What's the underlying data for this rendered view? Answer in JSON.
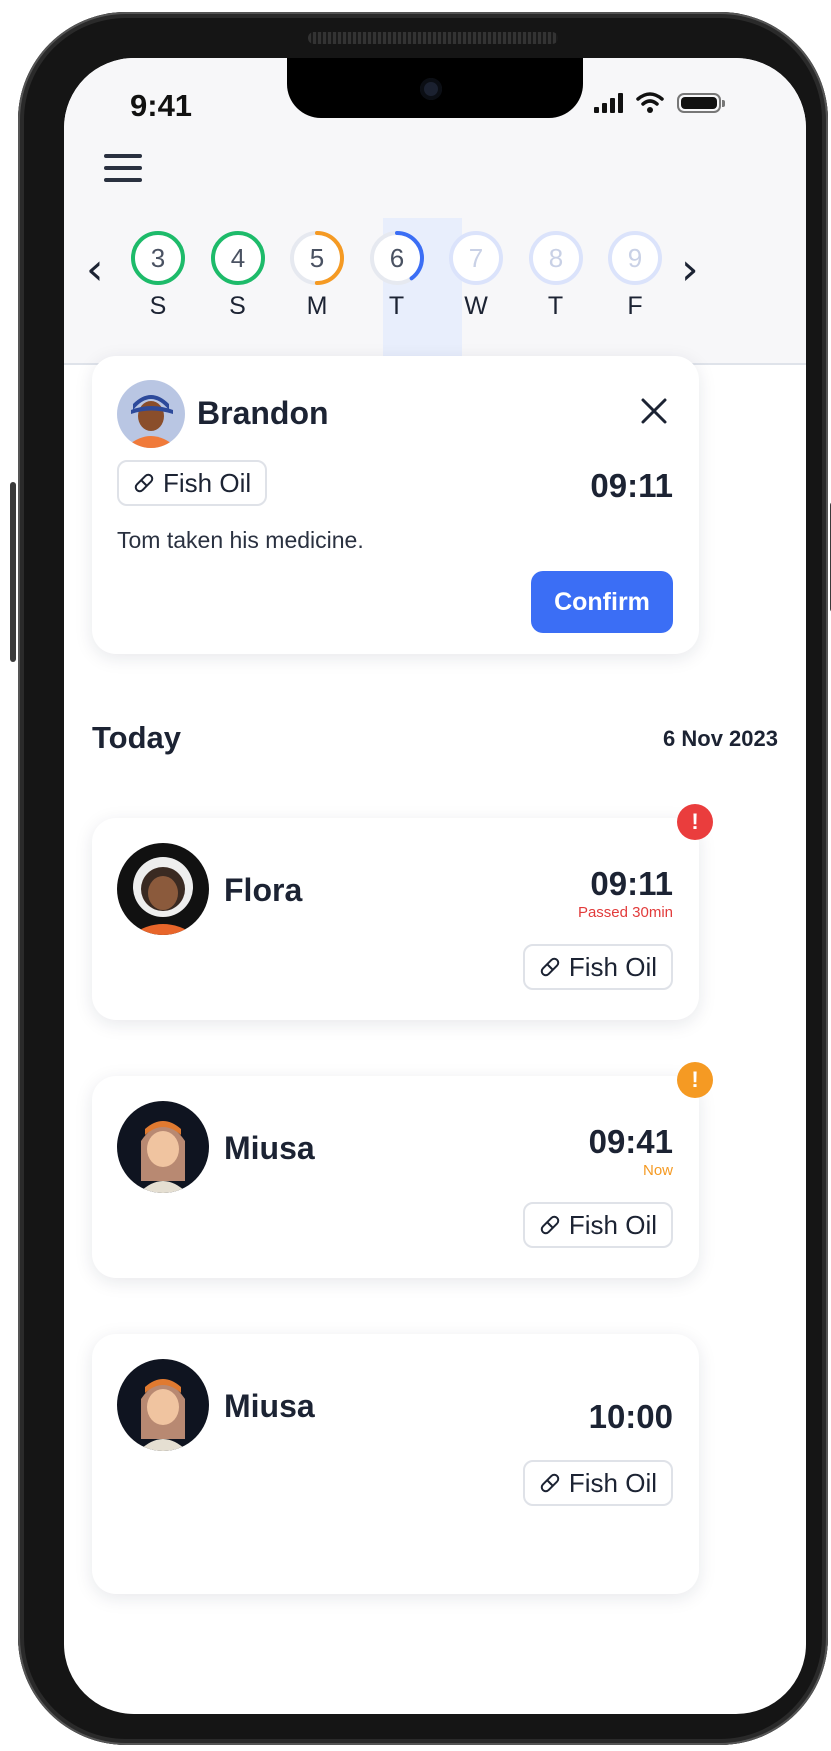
{
  "status_bar": {
    "time": "9:41"
  },
  "menu": {
    "icon": "hamburger-menu-icon"
  },
  "week": {
    "prev_icon": "chevron-left-icon",
    "next_icon": "chevron-right-icon",
    "days": [
      {
        "number": "3",
        "letter": "S",
        "state": "done",
        "ring_color": "#1dbb6a",
        "progress": 1.0
      },
      {
        "number": "4",
        "letter": "S",
        "state": "done",
        "ring_color": "#1dbb6a",
        "progress": 1.0
      },
      {
        "number": "5",
        "letter": "M",
        "state": "partial",
        "ring_color": "#f59a23",
        "progress": 0.5
      },
      {
        "number": "6",
        "letter": "T",
        "state": "today",
        "ring_color": "#3b6ef5",
        "progress": 0.4
      },
      {
        "number": "7",
        "letter": "W",
        "state": "future",
        "ring_color": "#dbe3fb",
        "progress": 0
      },
      {
        "number": "8",
        "letter": "T",
        "state": "future",
        "ring_color": "#dbe3fb",
        "progress": 0
      },
      {
        "number": "9",
        "letter": "F",
        "state": "future",
        "ring_color": "#dbe3fb",
        "progress": 0
      }
    ]
  },
  "notification": {
    "name": "Brandon",
    "medicine": "Fish Oil",
    "time": "09:11",
    "message": "Tom taken his medicine.",
    "confirm_label": "Confirm"
  },
  "section": {
    "title": "Today",
    "date": "6 Nov 2023"
  },
  "reminders": [
    {
      "name": "Flora",
      "time": "09:11",
      "status": "Passed 30min",
      "status_color": "#e23b3b",
      "alert_color": "#ea3d3d",
      "medicine": "Fish Oil"
    },
    {
      "name": "Miusa",
      "time": "09:41",
      "status": "Now",
      "status_color": "#f59a23",
      "alert_color": "#f59a23",
      "medicine": "Fish Oil"
    },
    {
      "name": "Miusa",
      "time": "10:00",
      "status": "",
      "medicine": "Fish Oil"
    }
  ],
  "colors": {
    "primary": "#3b6ef5",
    "danger": "#ea3d3d",
    "warning": "#f59a23",
    "success": "#1dbb6a"
  }
}
